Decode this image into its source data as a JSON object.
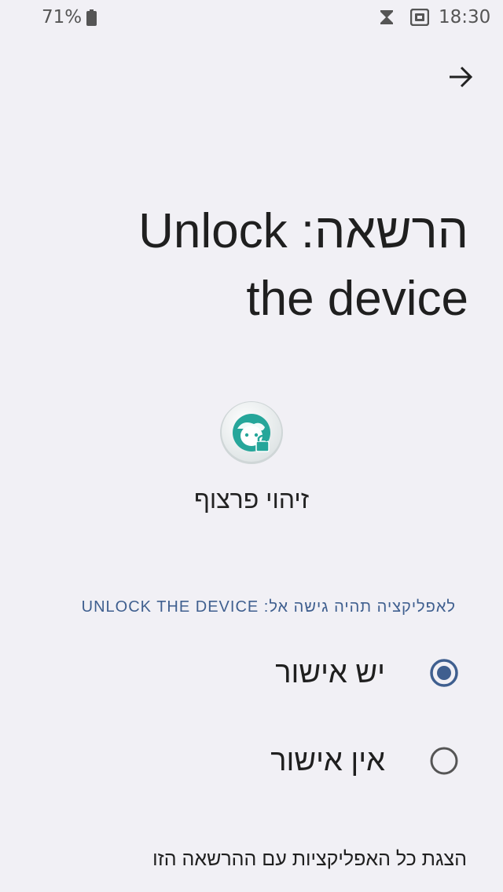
{
  "status_bar": {
    "battery_percent": "71%",
    "time": "18:30",
    "icons": [
      "battery-icon",
      "hourglass-icon",
      "sim-card-icon"
    ]
  },
  "toolbar": {
    "next_icon": "arrow-forward-icon"
  },
  "title": {
    "line1": "הרשאה: Unlock",
    "line2": "the device"
  },
  "app": {
    "icon": "face-lock-icon",
    "name": "זיהוי פרצוף",
    "icon_color": "#26a69a"
  },
  "permission": {
    "header": "לאפליקציה תהיה גישה אל: UNLOCK THE DEVICE",
    "options": [
      {
        "label": "יש אישור",
        "selected": true
      },
      {
        "label": "אין אישור",
        "selected": false
      }
    ],
    "accent_color": "#3f5f8f"
  },
  "footer": {
    "link": "הצגת כל האפליקציות עם ההרשאה הזו"
  }
}
